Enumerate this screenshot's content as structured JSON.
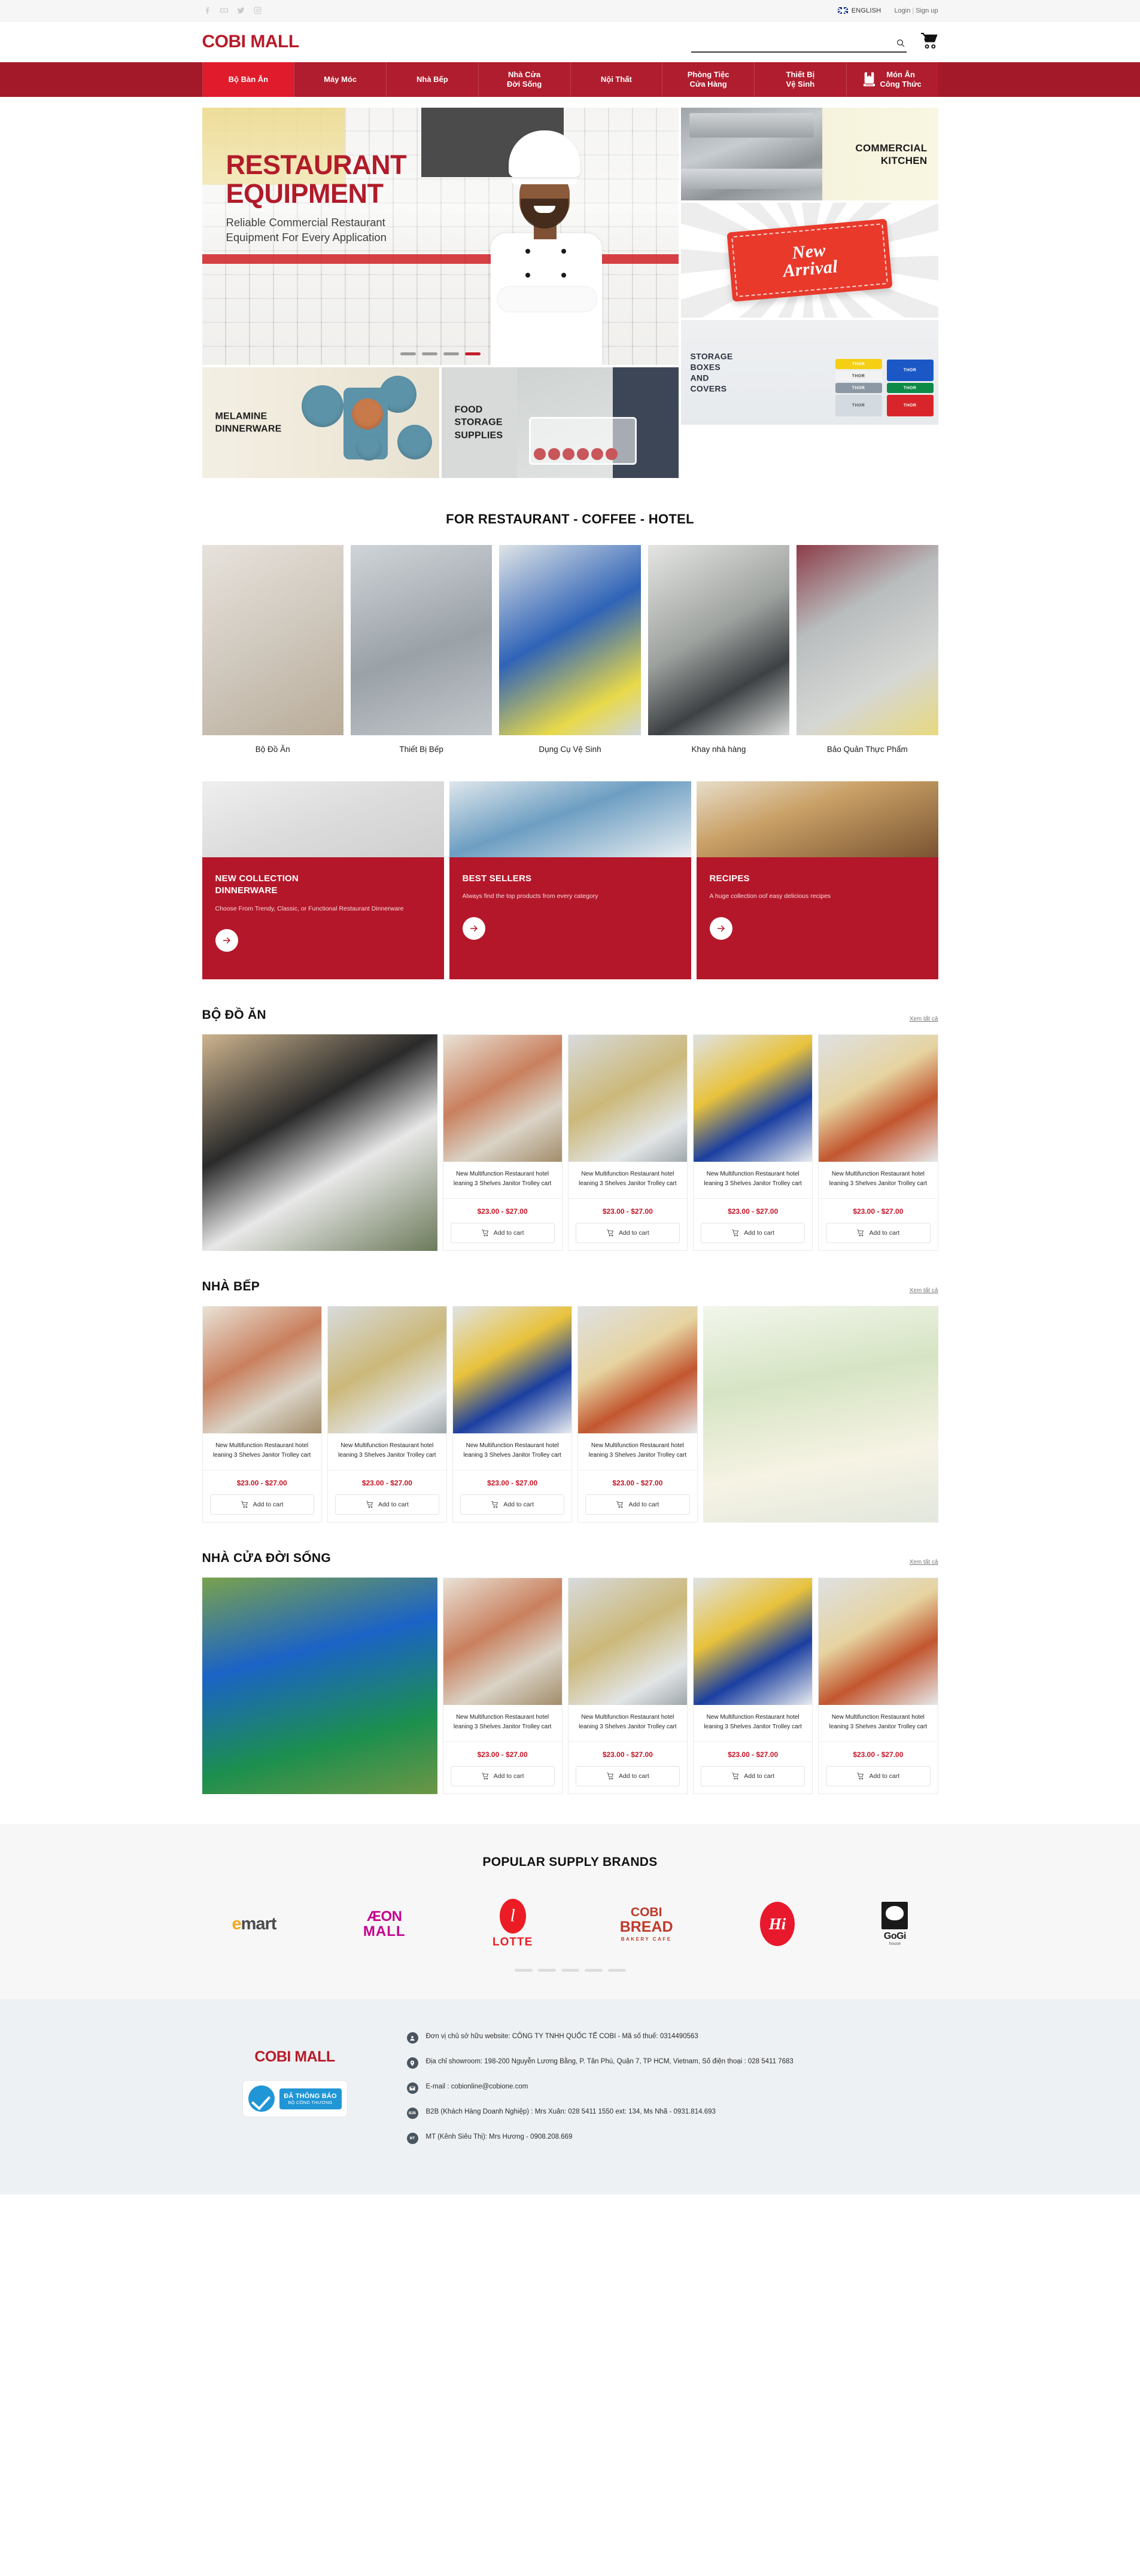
{
  "topbar": {
    "social": [
      {
        "name": "facebook-icon",
        "label": "Facebook"
      },
      {
        "name": "youtube-icon",
        "label": "YouTube"
      },
      {
        "name": "twitter-icon",
        "label": "Twitter"
      },
      {
        "name": "instagram-icon",
        "label": "Instagram"
      }
    ],
    "language": "ENGLISH",
    "login": "Login",
    "separator": "|",
    "signup": "Sign up"
  },
  "header": {
    "logo": "COBI MALL",
    "search_placeholder": "",
    "search_value": "",
    "search_icon": "search-icon",
    "cart_icon": "shopping-cart-icon"
  },
  "nav": {
    "items": [
      {
        "label": "Bộ Bàn Ăn",
        "active": true
      },
      {
        "label": "Máy Móc",
        "active": false
      },
      {
        "label": "Nhà Bếp",
        "active": false
      },
      {
        "label": "Nhà Cửa\nĐời Sống",
        "active": false
      },
      {
        "label": "Nội Thất",
        "active": false
      },
      {
        "label": "Phòng Tiệc\nCửa Hàng",
        "active": false
      },
      {
        "label": "Thiết Bị\nVệ Sinh",
        "active": false
      },
      {
        "label": "Món Ăn\nCông Thức",
        "active": false,
        "icon": "recipe-book-icon"
      }
    ]
  },
  "hero": {
    "main": {
      "title": "RESTAURANT EQUIPMENT",
      "title_line1": "RESTAURANT",
      "title_line2": "EQUIPMENT",
      "subtitle_line1": "Reliable Commercial Restaurant",
      "subtitle_line2": "Equipment For Every Application",
      "dots": 4,
      "active_dot": 4
    },
    "melamine": {
      "line1": "MELAMINE",
      "line2": "DINNERWARE"
    },
    "food_storage": {
      "line1": "FOOD",
      "line2": "STORAGE",
      "line3": "SUPPLIES"
    },
    "commercial_kitchen": {
      "line1": "COMMERCIAL",
      "line2": "KITCHEN"
    },
    "new_arrival": {
      "line1": "New",
      "line2": "Arrival"
    },
    "storage_boxes": {
      "line1": "STORAGE",
      "line2": "BOXES",
      "line3": "AND",
      "line4": "COVERS",
      "bin_label": "THOR"
    }
  },
  "categories_section": {
    "title": "FOR RESTAURANT - COFFEE - HOTEL",
    "items": [
      {
        "name": "Bộ Đồ Ăn"
      },
      {
        "name": "Thiết Bị Bếp"
      },
      {
        "name": "Dụng Cụ Vệ Sinh"
      },
      {
        "name": "Khay nhà hàng"
      },
      {
        "name": "Bảo Quản Thực Phẩm"
      }
    ]
  },
  "promos": [
    {
      "title_line1": "NEW COLLECTION",
      "title_line2": "DINNERWARE",
      "desc": "Choose From Trendy, Classic, or Functional Restaurant Dinnerware",
      "arrow_icon": "arrow-right-icon"
    },
    {
      "title_line1": "BEST SELLERS",
      "title_line2": "",
      "desc": "Always find the top products from every category",
      "arrow_icon": "arrow-right-icon"
    },
    {
      "title_line1": "RECIPES",
      "title_line2": "",
      "desc": "A huge collection oof easy delicious recipes",
      "arrow_icon": "arrow-right-icon"
    }
  ],
  "product_common": {
    "title": "New Multifunction Restaurant hotel leaning 3 Shelves Janitor Trolley cart",
    "price": "$23.00 - $27.00",
    "add_to_cart": "Add to cart",
    "cart_icon": "cart-icon",
    "view_all": "Xem tất cả"
  },
  "sections": [
    {
      "heading": "BỘ ĐỒ ĂN",
      "view_all": "Xem tất cả",
      "feature_position": "left",
      "product_count": 4
    },
    {
      "heading": "NHÀ BẾP",
      "view_all": "Xem tất cả",
      "feature_position": "right",
      "product_count": 4
    },
    {
      "heading": "NHÀ CỬA ĐỜI SỐNG",
      "view_all": "Xem tất cả",
      "feature_position": "left",
      "product_count": 4
    }
  ],
  "brands_section": {
    "title": "POPULAR SUPPLY BRANDS",
    "brands": [
      {
        "name": "emart",
        "e": "e",
        "rest": "mart"
      },
      {
        "name": "AEON MALL",
        "t1": "ÆON",
        "t2": "MALL"
      },
      {
        "name": "LOTTE",
        "txt": "LOTTE"
      },
      {
        "name": "COBI BREAD",
        "l1": "COBI",
        "l2": "BREAD",
        "l3": "BAKERY  CAFE"
      },
      {
        "name": "Hi",
        "txt": "Hi"
      },
      {
        "name": "GoGi house",
        "txt": "GoGi",
        "sub": "house"
      }
    ],
    "dots": 5
  },
  "footer": {
    "logo": "COBI MALL",
    "badge": {
      "line1": "ĐÃ THÔNG BÁO",
      "line2": "BỘ CÔNG THƯƠNG",
      "icon": "blue-check-icon"
    },
    "rows": [
      {
        "icon": "user-icon",
        "icon_text": "",
        "text": "Đơn vị chủ sở hữu website: CÔNG TY TNHH QUỐC TẾ COBI - Mã số thuế: 0314490563"
      },
      {
        "icon": "location-pin-icon",
        "icon_text": "",
        "text": "Địa chỉ showroom: 198-200 Nguyễn Lương Bằng, P. Tân Phú, Quận 7, TP HCM, Vietnam, Số điện thoại : 028 5411 7683"
      },
      {
        "icon": "envelope-icon",
        "icon_text": "",
        "text": "E-mail : cobionline@cobione.com"
      },
      {
        "icon": "b2b-icon",
        "icon_text": "B2B",
        "text": "B2B (Khách Hàng Doanh Nghiệp) : Mrs Xuân: 028 5411 1550 ext: 134, Ms Nhã - 0931.814.693"
      },
      {
        "icon": "mt-icon",
        "icon_text": "MT",
        "text": "MT (Kênh Siêu Thị): Mrs Hương - 0908.208.669"
      }
    ]
  },
  "colors": {
    "brand_red": "#b81b28",
    "nav_red": "#b01d2e",
    "nav_active_red": "#e01b2b",
    "price_red": "#c41425",
    "promo_red": "#b5172a"
  }
}
